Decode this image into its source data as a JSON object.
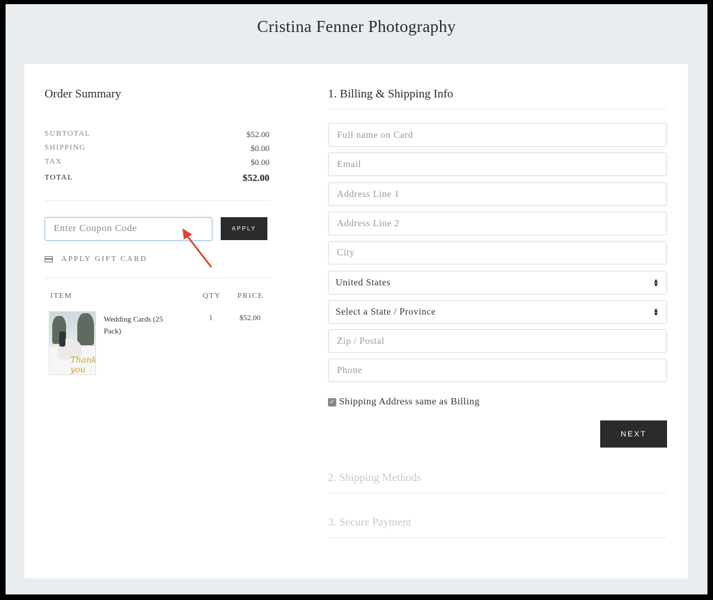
{
  "site": {
    "title": "Cristina Fenner Photography"
  },
  "order_summary": {
    "title": "Order Summary",
    "rows": [
      {
        "label": "SUBTOTAL",
        "value": "$52.00"
      },
      {
        "label": "SHIPPING",
        "value": "$0.00"
      },
      {
        "label": "TAX",
        "value": "$0.00"
      }
    ],
    "total": {
      "label": "TOTAL",
      "value": "$52.00"
    },
    "coupon": {
      "placeholder": "Enter Coupon Code",
      "apply_label": "APPLY"
    },
    "gift_card_label": "APPLY GIFT CARD",
    "items_header": {
      "item": "ITEM",
      "qty": "QTY",
      "price": "PRICE"
    },
    "items": [
      {
        "name": "Wedding Cards (25 Pack)",
        "qty": "1",
        "price": "$52.00",
        "thumb_text": "Thank you"
      }
    ]
  },
  "billing": {
    "title": "1. Billing & Shipping Info",
    "fields": {
      "full_name": "Full name on Card",
      "email": "Email",
      "address1": "Address Line 1",
      "address2": "Address Line 2",
      "city": "City",
      "zip": "Zip / Postal",
      "phone": "Phone"
    },
    "country": "United States",
    "state": "Select a State / Province",
    "same_address_label": "Shipping Address same as Billing",
    "same_address_checked": true,
    "next_label": "NEXT"
  },
  "steps": {
    "shipping_methods": "2. Shipping Methods",
    "secure_payment": "3. Secure Payment"
  },
  "colors": {
    "page_bg": "#e9edef",
    "button_bg": "#2b2b2b",
    "arrow": "#e0432b",
    "inactive_step": "#c8c8c8"
  }
}
